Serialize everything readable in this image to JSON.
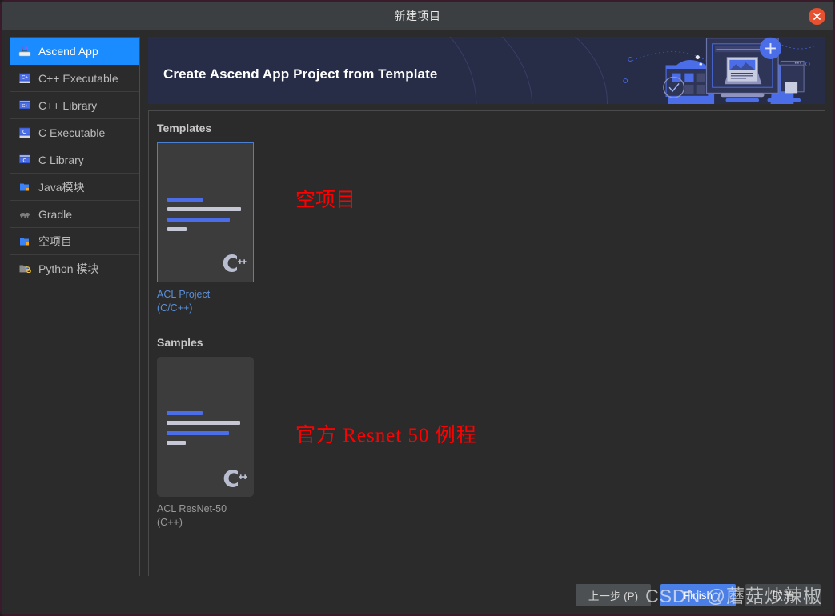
{
  "window": {
    "title": "新建项目",
    "close_icon": "close-icon"
  },
  "sidebar": {
    "items": [
      {
        "label": "Ascend App",
        "icon": "ascend-app-icon",
        "selected": true
      },
      {
        "label": "C++ Executable",
        "icon": "cpp-executable-icon",
        "selected": false
      },
      {
        "label": "C++ Library",
        "icon": "cpp-library-icon",
        "selected": false
      },
      {
        "label": "C Executable",
        "icon": "c-executable-icon",
        "selected": false
      },
      {
        "label": "C Library",
        "icon": "c-library-icon",
        "selected": false
      },
      {
        "label": "Java模块",
        "icon": "java-module-icon",
        "selected": false
      },
      {
        "label": "Gradle",
        "icon": "gradle-elephant-icon",
        "selected": false
      },
      {
        "label": "空项目",
        "icon": "empty-project-icon",
        "selected": false
      },
      {
        "label": "Python 模块",
        "icon": "python-module-icon",
        "selected": false
      }
    ]
  },
  "banner": {
    "title": "Create Ascend App Project from Template",
    "background_color": "#272c47",
    "accent_color": "#4b6ee8"
  },
  "main": {
    "templates": {
      "heading": "Templates",
      "cards": [
        {
          "name_line1": "ACL Project",
          "name_line2": "(C/C++)",
          "selected": true,
          "logo": "cpp-logo-icon"
        }
      ],
      "annotation": "空项目"
    },
    "samples": {
      "heading": "Samples",
      "cards": [
        {
          "name_line1": "ACL ResNet-50",
          "name_line2": "(C++)",
          "selected": false,
          "logo": "cpp-logo-icon"
        }
      ],
      "annotation": "官方  Resnet 50  例程"
    }
  },
  "footer": {
    "previous_label": "上一步 (P)",
    "finish_label": "Finish",
    "cancel_label": "取消"
  },
  "watermark": {
    "text": "CSDN @蘑菇炒辣椒"
  },
  "colors": {
    "accent_blue": "#1a8cff",
    "button_blue": "#4b7fe8",
    "annotation_red": "#ff0000",
    "close_orange": "#e8512f",
    "panel_bg": "#2b2b2b",
    "titlebar_bg": "#3c3f41"
  }
}
